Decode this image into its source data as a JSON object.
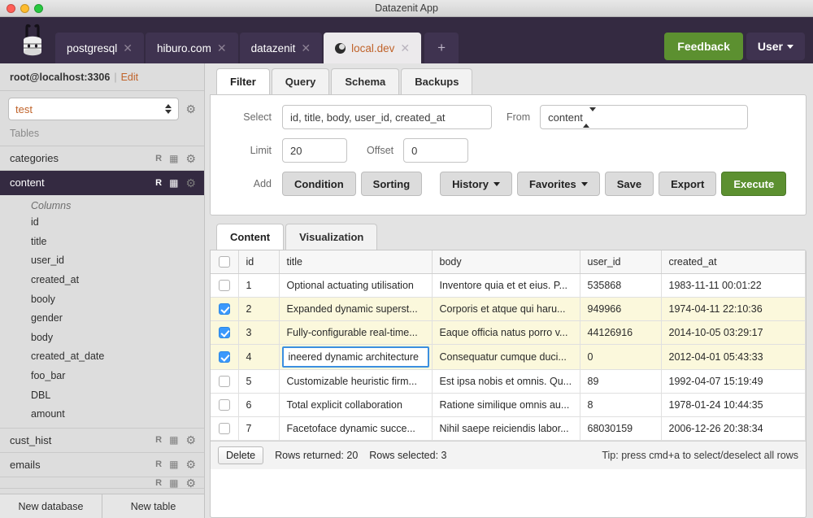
{
  "window": {
    "title": "Datazenit App",
    "controls": [
      "close",
      "minimize",
      "maximize"
    ]
  },
  "appbar": {
    "logo_name": "datazenit-logo",
    "tabs": [
      {
        "label": "postgresql",
        "active": false,
        "icon": null
      },
      {
        "label": "hiburo.com",
        "active": false,
        "icon": null
      },
      {
        "label": "datazenit",
        "active": false,
        "icon": null
      },
      {
        "label": "local.dev",
        "active": true,
        "icon": "globe-icon"
      }
    ],
    "add_tab_label": "+",
    "feedback_label": "Feedback",
    "user_label": "User"
  },
  "sidebar": {
    "connection": "root@localhost:3306",
    "separator": "|",
    "edit_label": "Edit",
    "database_selected": "test",
    "database_gear": "gear-icon",
    "tables_label": "Tables",
    "tables": [
      {
        "name": "categories",
        "selected": false,
        "icons": [
          "R",
          "grid-icon",
          "gear-icon"
        ]
      },
      {
        "name": "content",
        "selected": true,
        "icons": [
          "R",
          "grid-icon",
          "gear-icon"
        ]
      },
      {
        "name": "cust_hist",
        "selected": false,
        "icons": [
          "R",
          "grid-icon",
          "gear-icon"
        ]
      },
      {
        "name": "emails",
        "selected": false,
        "icons": [
          "R",
          "grid-icon",
          "gear-icon"
        ]
      }
    ],
    "columns_label": "Columns",
    "columns": [
      "id",
      "title",
      "user_id",
      "created_at",
      "booly",
      "gender",
      "body",
      "created_at_date",
      "foo_bar",
      "DBL",
      "amount"
    ],
    "footer": {
      "new_database": "New database",
      "new_table": "New table"
    }
  },
  "main": {
    "panel_tabs": [
      {
        "label": "Filter",
        "active": true
      },
      {
        "label": "Query",
        "active": false
      },
      {
        "label": "Schema",
        "active": false
      },
      {
        "label": "Backups",
        "active": false
      }
    ],
    "filter": {
      "select_label": "Select",
      "select_value": "id, title, body, user_id, created_at",
      "from_label": "From",
      "from_value": "content",
      "limit_label": "Limit",
      "limit_value": "20",
      "offset_label": "Offset",
      "offset_value": "0",
      "add_label": "Add",
      "buttons": [
        {
          "label": "Condition",
          "style": "default",
          "caret": false
        },
        {
          "label": "Sorting",
          "style": "default",
          "caret": false
        },
        {
          "label": "History",
          "style": "default",
          "caret": true
        },
        {
          "label": "Favorites",
          "style": "default",
          "caret": true
        },
        {
          "label": "Save",
          "style": "default",
          "caret": false
        },
        {
          "label": "Export",
          "style": "default",
          "caret": false
        },
        {
          "label": "Execute",
          "style": "green",
          "caret": false
        }
      ]
    },
    "result_tabs": [
      {
        "label": "Content",
        "active": true
      },
      {
        "label": "Visualization",
        "active": false
      }
    ],
    "grid": {
      "columns": [
        "id",
        "title",
        "body",
        "user_id",
        "created_at"
      ],
      "header_checkbox": false,
      "rows": [
        {
          "checked": false,
          "editing": false,
          "id": "1",
          "title": "Optional actuating utilisation",
          "body": "Inventore quia et et eius. P...",
          "user_id": "535868",
          "created_at": "1983-11-11 00:01:22"
        },
        {
          "checked": true,
          "editing": false,
          "id": "2",
          "title": "Expanded dynamic superst...",
          "body": "Corporis et atque qui haru...",
          "user_id": "949966",
          "created_at": "1974-04-11 22:10:36"
        },
        {
          "checked": true,
          "editing": false,
          "id": "3",
          "title": "Fully-configurable real-time...",
          "body": "Eaque officia natus porro v...",
          "user_id": "44126916",
          "created_at": "2014-10-05 03:29:17"
        },
        {
          "checked": true,
          "editing": true,
          "id": "4",
          "title": "ineered dynamic architecture",
          "body": "Consequatur cumque duci...",
          "user_id": "0",
          "created_at": "2012-04-01 05:43:33"
        },
        {
          "checked": false,
          "editing": false,
          "id": "5",
          "title": "Customizable heuristic firm...",
          "body": "Est ipsa nobis et omnis. Qu...",
          "user_id": "89",
          "created_at": "1992-04-07 15:19:49"
        },
        {
          "checked": false,
          "editing": false,
          "id": "6",
          "title": "Total explicit collaboration",
          "body": "Ratione similique omnis au...",
          "user_id": "8",
          "created_at": "1978-01-24 10:44:35"
        },
        {
          "checked": false,
          "editing": false,
          "id": "7",
          "title": "Facetoface dynamic succe...",
          "body": "Nihil saepe reiciendis labor...",
          "user_id": "68030159",
          "created_at": "2006-12-26 20:38:34"
        }
      ],
      "footer": {
        "delete_label": "Delete",
        "rows_returned": "Rows returned: 20",
        "rows_selected": "Rows selected: 3",
        "tip": "Tip: press cmd+a to select/deselect all rows"
      }
    }
  },
  "colors": {
    "brand_dark": "#342a41",
    "tab_inactive": "#3f3350",
    "accent_green": "#5c9030",
    "link_orange": "#c0632a",
    "row_selected": "#fbf8dc",
    "checkbox_blue": "#3b99fc"
  }
}
